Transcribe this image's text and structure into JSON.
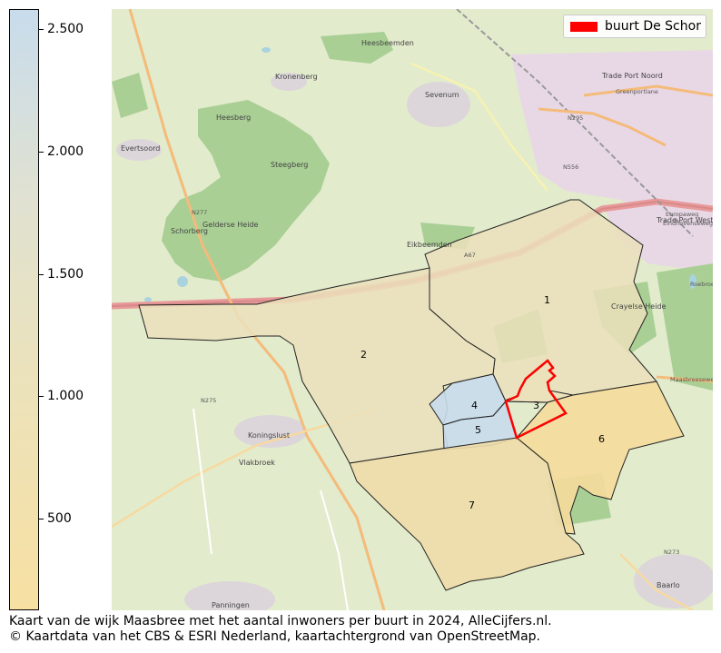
{
  "colorbar": {
    "ticks": [
      "2.500",
      "2.000",
      "1.500",
      "1.000",
      "500"
    ]
  },
  "legend": {
    "label": "buurt De Schor",
    "color": "#ff0000"
  },
  "neighbourhoods": [
    {
      "label": "1",
      "fill": "#ebe0bb"
    },
    {
      "label": "2",
      "fill": "#ebe0bb"
    },
    {
      "label": "3",
      "fill": "#ebe0bb",
      "highlight": true
    },
    {
      "label": "4",
      "fill": "#c8dcec"
    },
    {
      "label": "5",
      "fill": "#c8dcec"
    },
    {
      "label": "6",
      "fill": "#f5dc9c"
    },
    {
      "label": "7",
      "fill": "#f0ddaa"
    }
  ],
  "places": [
    "Kronenberg",
    "Sevenum",
    "Evertsoord",
    "Trade Port Noord",
    "Trade Port West",
    "Heesberg",
    "Steegberg",
    "Gelderse Heide",
    "Schorberg",
    "Heesbeemden",
    "Eikbeemden",
    "Crayelse Heide",
    "Koningslust",
    "Panningen",
    "Baarlo",
    "Vlakbroek",
    "Greenportlane",
    "Europaweg",
    "Maasbreeseweg",
    "Roebroek",
    "Eindhovenseweg"
  ],
  "roads": [
    "N295",
    "N556",
    "N277",
    "N275",
    "N273",
    "A67"
  ],
  "caption": {
    "line1": "Kaart van de wijk Maasbree met het aantal inwoners per buurt in 2024, AlleCijfers.nl.",
    "line2": "© Kaartdata van het CBS & ESRI Nederland, kaartachtergrond van OpenStreetMap."
  }
}
